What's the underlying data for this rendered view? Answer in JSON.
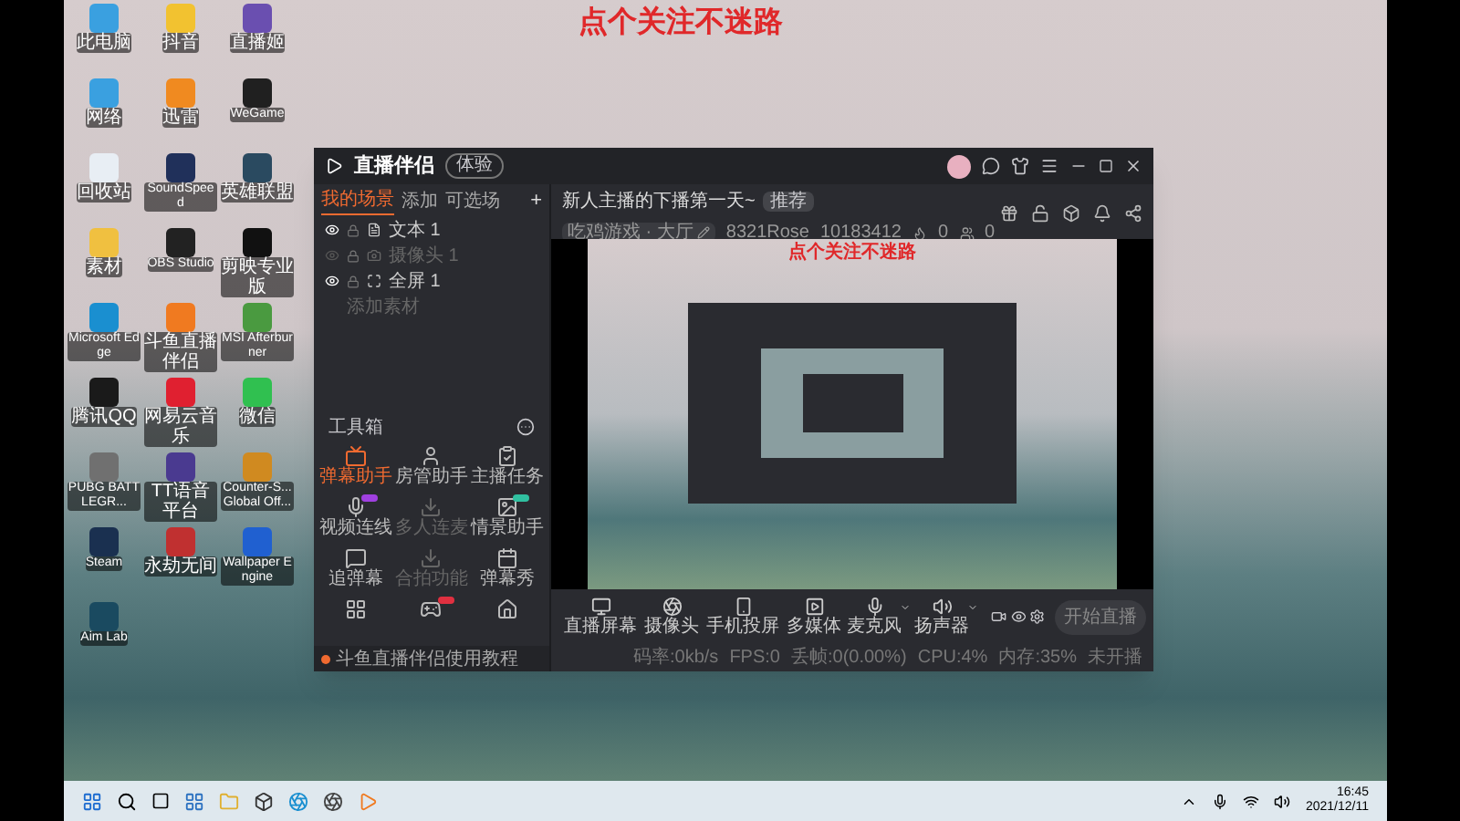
{
  "caption": "点个关注不迷路",
  "desktop_icons": [
    {
      "label": "此电脑",
      "color": "#3aa0e0"
    },
    {
      "label": "抖音",
      "color": "#f2c230"
    },
    {
      "label": "直播姬",
      "color": "#6a4fb0"
    },
    {
      "label": "网络",
      "color": "#3aa0e0"
    },
    {
      "label": "迅雷",
      "color": "#f08a20"
    },
    {
      "label": "WeGame",
      "color": "#202020"
    },
    {
      "label": "回收站",
      "color": "#e8eef4"
    },
    {
      "label": "SoundSpeed",
      "color": "#20305a"
    },
    {
      "label": "英雄联盟",
      "color": "#2a4a60"
    },
    {
      "label": "素材",
      "color": "#f0c040"
    },
    {
      "label": "OBS Studio",
      "color": "#222222"
    },
    {
      "label": "剪映专业版",
      "color": "#111111"
    },
    {
      "label": "Microsoft Edge",
      "color": "#1a8fd0"
    },
    {
      "label": "斗鱼直播伴侣",
      "color": "#f07a20"
    },
    {
      "label": "MSI Afterburner",
      "color": "#4a9a40"
    },
    {
      "label": "腾讯QQ",
      "color": "#1a1a1a"
    },
    {
      "label": "网易云音乐",
      "color": "#e02030"
    },
    {
      "label": "微信",
      "color": "#30c050"
    },
    {
      "label": "PUBG BATTLEGR...",
      "color": "#707070"
    },
    {
      "label": "TT语音平台",
      "color": "#4a3a90"
    },
    {
      "label": "Counter-S... Global Off...",
      "color": "#d08a20"
    },
    {
      "label": "Steam",
      "color": "#1a3050"
    },
    {
      "label": "永劫无间",
      "color": "#c03030"
    },
    {
      "label": "Wallpaper Engine",
      "color": "#2060d0"
    },
    {
      "label": "Aim Lab",
      "color": "#1a4a60"
    }
  ],
  "app": {
    "title": "直播伴侣",
    "badge": "体验",
    "tabs": [
      {
        "label": "我的场景",
        "selected": true
      },
      {
        "label": "添加",
        "selected": false
      },
      {
        "label": "可选场",
        "selected": false
      }
    ],
    "add_tab": "+",
    "sources": [
      {
        "label": "文本 1",
        "visible": true
      },
      {
        "label": "摄像头 1",
        "visible": false
      },
      {
        "label": "全屏 1",
        "visible": true
      }
    ],
    "add_source": "添加素材",
    "toolbox_title": "工具箱",
    "tools": [
      {
        "label": "弹幕助手",
        "selected": true,
        "disabled": false
      },
      {
        "label": "房管助手",
        "selected": false,
        "disabled": false
      },
      {
        "label": "主播任务",
        "selected": false,
        "disabled": false
      },
      {
        "label": "视频连线",
        "selected": false,
        "disabled": false,
        "color": "#a040e0"
      },
      {
        "label": "多人连麦",
        "selected": false,
        "disabled": true
      },
      {
        "label": "情景助手",
        "selected": false,
        "disabled": false,
        "color": "#30c0a0"
      },
      {
        "label": "追弹幕",
        "selected": false,
        "disabled": false
      },
      {
        "label": "合拍功能",
        "selected": false,
        "disabled": true
      },
      {
        "label": "弹幕秀",
        "selected": false,
        "disabled": false
      },
      {
        "selected": false,
        "disabled": false
      },
      {
        "selected": false,
        "disabled": false,
        "color": "#e03040"
      },
      {
        "selected": false,
        "disabled": false
      }
    ],
    "notice": "斗鱼直播伴侣使用教程",
    "stream": {
      "title": "新人主播的下播第一天~",
      "tag": "推荐",
      "category": "吃鸡游戏 · 大厅",
      "user": "8321Rose",
      "room": "10183412",
      "likes": "0",
      "viewers": "0"
    },
    "preview_caption": "点个关注不迷路",
    "controls": [
      {
        "label": "直播屏幕",
        "menu": false
      },
      {
        "label": "摄像头",
        "menu": false
      },
      {
        "label": "手机投屏",
        "menu": false
      },
      {
        "label": "多媒体",
        "menu": false
      },
      {
        "label": "麦克风",
        "menu": true
      },
      {
        "label": "扬声器",
        "menu": true
      }
    ],
    "start_button": "开始直播",
    "stats": [
      "码率:0kb/s",
      "FPS:0",
      "丢帧:0(0.00%)",
      "CPU:4%",
      "内存:35%",
      "未开播"
    ]
  },
  "taskbar": {
    "time": "16:45",
    "date": "2021/12/11"
  }
}
